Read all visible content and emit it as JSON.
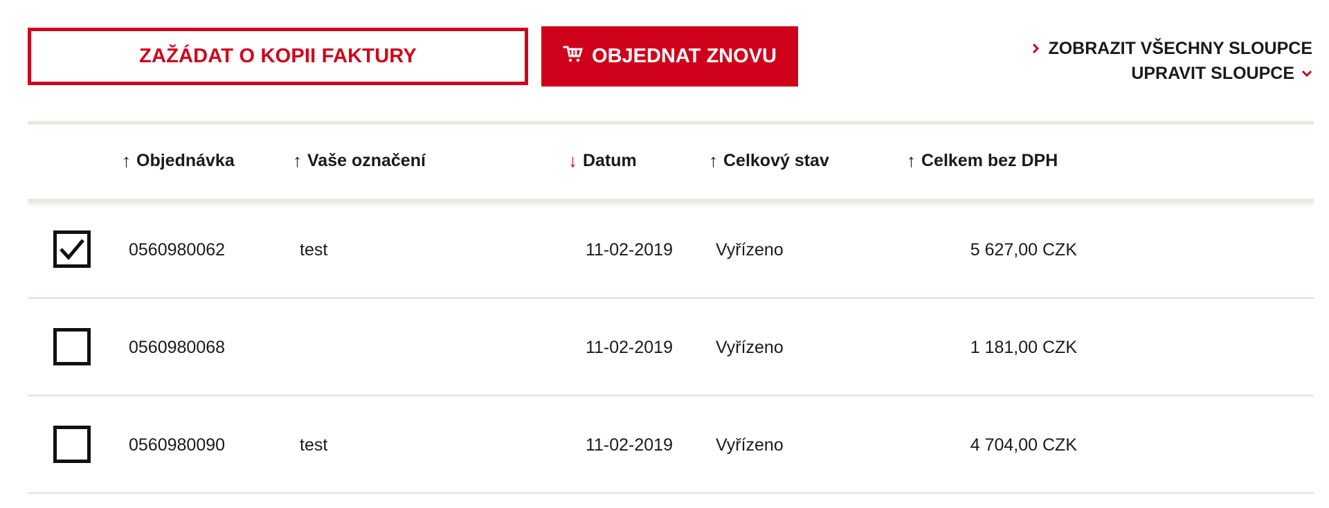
{
  "toolbar": {
    "request_copy_label": "ZAŽÁDAT O KOPII FAKTURY",
    "reorder_label": "OBJEDNAT ZNOVU",
    "show_all_columns_label": "ZOBRAZIT VŠECHNY SLOUPCE",
    "edit_columns_label": "UPRAVIT SLOUPCE"
  },
  "colors": {
    "accent": "#d0021b",
    "separator": "#ece7e0",
    "text": "#1a1a1a"
  },
  "table": {
    "columns": [
      {
        "label": "Objednávka",
        "sort": "asc",
        "active": false
      },
      {
        "label": "Vaše označení",
        "sort": "asc",
        "active": false
      },
      {
        "label": "Datum",
        "sort": "desc",
        "active": true
      },
      {
        "label": "Celkový stav",
        "sort": "asc",
        "active": false
      },
      {
        "label": "Celkem bez DPH",
        "sort": "asc",
        "active": false
      }
    ],
    "rows": [
      {
        "checked": true,
        "order": "0560980062",
        "reference": "test",
        "date": "11-02-2019",
        "status": "Vyřízeno",
        "total": "5 627,00 CZK"
      },
      {
        "checked": false,
        "order": "0560980068",
        "reference": "",
        "date": "11-02-2019",
        "status": "Vyřízeno",
        "total": "1 181,00 CZK"
      },
      {
        "checked": false,
        "order": "0560980090",
        "reference": "test",
        "date": "11-02-2019",
        "status": "Vyřízeno",
        "total": "4 704,00 CZK"
      }
    ]
  },
  "icons": {
    "reorder": "cart-icon",
    "show_all": "chevron-right-icon",
    "edit": "chevron-down-icon",
    "sort_asc": "arrow-up-icon",
    "sort_desc": "arrow-down-icon",
    "checkbox_checked": "checkmark-icon"
  }
}
